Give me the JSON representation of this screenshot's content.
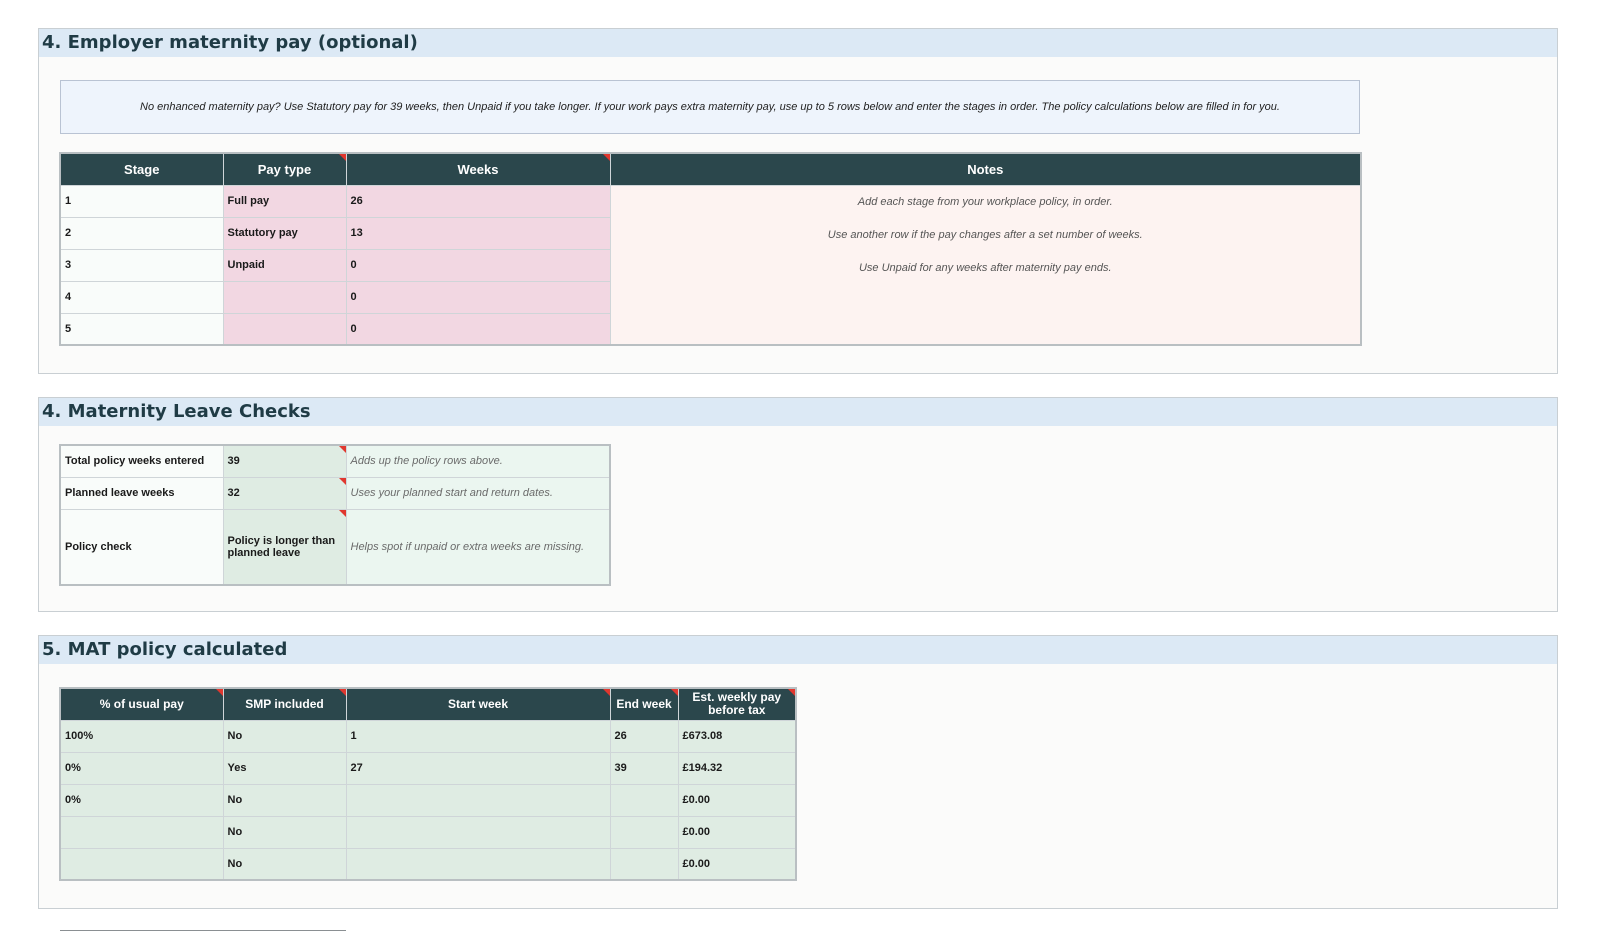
{
  "section_policy": {
    "title": "4. Employer maternity pay (optional)",
    "intro": "No enhanced maternity pay? Use Statutory pay for 39 weeks, then Unpaid if you take longer. If your work pays extra maternity pay, use up to 5 rows below and enter the stages in order. The policy calculations below are filled in for you.",
    "headers": {
      "stage": "Stage",
      "pay_type": "Pay type",
      "weeks": "Weeks",
      "notes": "Notes"
    },
    "rows": [
      {
        "stage": "1",
        "pay_type": "Full pay",
        "weeks": "26"
      },
      {
        "stage": "2",
        "pay_type": "Statutory pay",
        "weeks": "13"
      },
      {
        "stage": "3",
        "pay_type": "Unpaid",
        "weeks": "0"
      },
      {
        "stage": "4",
        "pay_type": "",
        "weeks": "0"
      },
      {
        "stage": "5",
        "pay_type": "",
        "weeks": "0"
      }
    ],
    "notes": [
      "Add each stage from your workplace policy, in order.",
      "Use another row if the pay changes after a set number of weeks.",
      "Use Unpaid for any weeks after maternity pay ends."
    ]
  },
  "section_checks": {
    "title": "4. Maternity Leave Checks",
    "rows": [
      {
        "label": "Total policy weeks entered",
        "value": "39",
        "help": "Adds up the policy rows above."
      },
      {
        "label": "Planned leave weeks",
        "value": "32",
        "help": "Uses your planned start and return dates."
      },
      {
        "label": "Policy check",
        "value": "Policy is longer than planned leave",
        "help": "Helps spot if unpaid or extra weeks are missing."
      }
    ]
  },
  "section_calc": {
    "title": "5. MAT policy calculated",
    "headers": {
      "pct": "% of usual pay",
      "smp": "SMP included",
      "start": "Start week",
      "end": "End week",
      "est": "Est. weekly pay before tax"
    },
    "rows": [
      {
        "pct": "100%",
        "smp": "No",
        "start": "1",
        "end": "26",
        "est": "£673.08"
      },
      {
        "pct": "0%",
        "smp": "Yes",
        "start": "27",
        "end": "39",
        "est": "£194.32"
      },
      {
        "pct": "0%",
        "smp": "No",
        "start": "",
        "end": "",
        "est": "£0.00"
      },
      {
        "pct": "",
        "smp": "No",
        "start": "",
        "end": "",
        "est": "£0.00"
      },
      {
        "pct": "",
        "smp": "No",
        "start": "",
        "end": "",
        "est": "£0.00"
      }
    ]
  },
  "colors": {
    "header_dark": "#2b474c",
    "section_header": "#dce9f5",
    "input_pink": "#f2d7e2",
    "calc_green": "#dfece3",
    "comment_flag": "#e0372e"
  }
}
